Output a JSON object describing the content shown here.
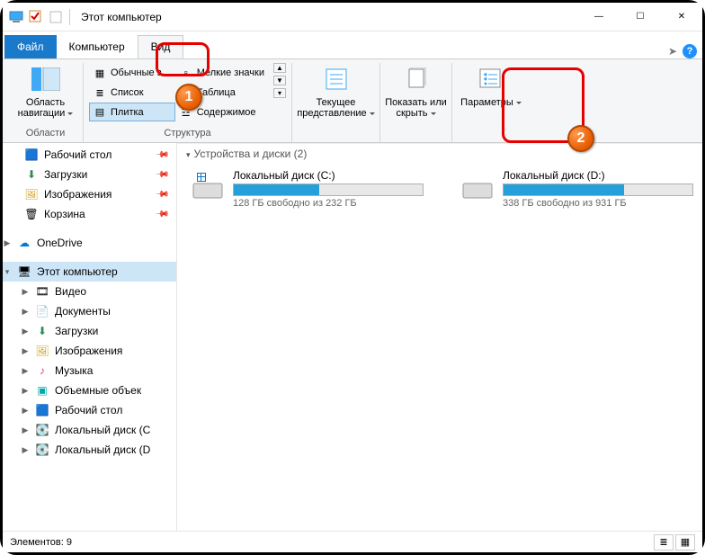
{
  "titlebar": {
    "title": "Этот компьютер"
  },
  "window_controls": {
    "min": "—",
    "max": "☐",
    "close": "✕"
  },
  "tabs": {
    "file": "Файл",
    "computer": "Компьютер",
    "view": "Вид"
  },
  "ribbon": {
    "nav_pane": {
      "label": "Область навигации",
      "group": "Области"
    },
    "layout": {
      "big_icons": "Обычные з",
      "list": "Список",
      "tiles": "Плитка",
      "small_icons": "Мелкие значки",
      "table": "Таблица",
      "content": "Содержимое",
      "group": "Структура"
    },
    "current_view": "Текущее представление",
    "show_hide": "Показать или скрыть",
    "options": "Параметры"
  },
  "nav": {
    "desktop": "Рабочий стол",
    "downloads": "Загрузки",
    "pictures": "Изображения",
    "recycle": "Корзина",
    "onedrive": "OneDrive",
    "this_pc": "Этот компьютер",
    "videos": "Видео",
    "documents": "Документы",
    "downloads2": "Загрузки",
    "pictures2": "Изображения",
    "music": "Музыка",
    "objects3d": "Объемные объек",
    "desktop2": "Рабочий стол",
    "drive_c": "Локальный диск (C",
    "drive_d": "Локальный диск (D"
  },
  "main": {
    "section": "Устройства и диски (2)",
    "drive_c": {
      "title": "Локальный диск (C:)",
      "sub": "128 ГБ свободно из 232 ГБ",
      "fill_pct": 45
    },
    "drive_d": {
      "title": "Локальный диск (D:)",
      "sub": "338 ГБ свободно из 931 ГБ",
      "fill_pct": 64
    }
  },
  "status": {
    "items": "Элементов: 9"
  },
  "annot": {
    "one": "1",
    "two": "2"
  }
}
